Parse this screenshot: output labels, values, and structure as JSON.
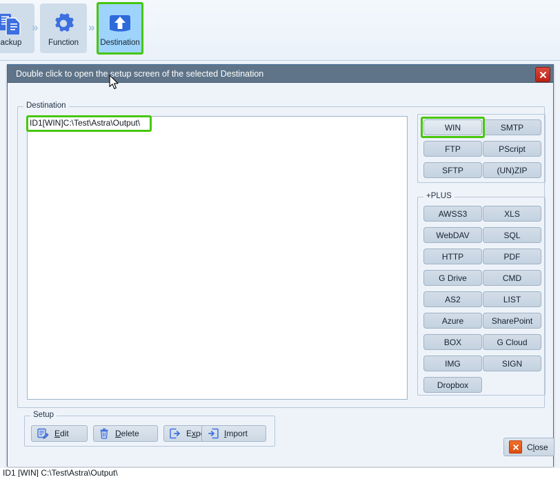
{
  "toolbar": {
    "steps": [
      {
        "label": "ackup",
        "icon": "documents-icon",
        "active": false
      },
      {
        "label": "Function",
        "icon": "gear-icon",
        "active": false
      },
      {
        "label": "Destination",
        "icon": "upload-arrow-icon",
        "active": true
      }
    ],
    "separator": "chevron-right-icon",
    "highlight_color": "#47c60c"
  },
  "dialog": {
    "title": "Double click to open the setup screen of the selected Destination",
    "title_close_icon": "close-x-icon",
    "titlebar_color": "#5f7489",
    "destination_group": {
      "label": "Destination",
      "list_items": [
        {
          "text": "ID1[WIN]C:\\Test\\Astra\\Output\\",
          "selected": true
        }
      ],
      "main_buttons": [
        {
          "label": "WIN",
          "selected": true
        },
        {
          "label": "SMTP",
          "selected": false
        },
        {
          "label": "FTP",
          "selected": false
        },
        {
          "label": "PScript",
          "selected": false
        },
        {
          "label": "SFTP",
          "selected": false
        },
        {
          "label": "(UN)ZIP",
          "selected": false
        }
      ],
      "plus_group": {
        "label": "+PLUS",
        "buttons": [
          {
            "label": "AWSS3"
          },
          {
            "label": "XLS"
          },
          {
            "label": "WebDAV"
          },
          {
            "label": "SQL"
          },
          {
            "label": "HTTP"
          },
          {
            "label": "PDF"
          },
          {
            "label": "G Drive"
          },
          {
            "label": "CMD"
          },
          {
            "label": "AS2"
          },
          {
            "label": "LIST"
          },
          {
            "label": "Azure"
          },
          {
            "label": "SharePoint"
          },
          {
            "label": "BOX"
          },
          {
            "label": "G Cloud"
          },
          {
            "label": "IMG"
          },
          {
            "label": "SIGN"
          },
          {
            "label": "Dropbox"
          }
        ]
      }
    },
    "setup_group": {
      "label": "Setup",
      "buttons": [
        {
          "pre": "",
          "accel": "E",
          "post": "dit",
          "icon": "edit-document-icon"
        },
        {
          "pre": "",
          "accel": "D",
          "post": "elete",
          "icon": "trash-icon"
        },
        {
          "pre": "E",
          "accel": "x",
          "post": "port",
          "icon": "export-arrow-icon"
        },
        {
          "pre": "",
          "accel": "I",
          "post": "mport",
          "icon": "import-arrow-icon"
        }
      ]
    },
    "close_button": {
      "pre": "C",
      "accel": "l",
      "post": "ose",
      "icon": "close-x-icon",
      "icon_color": "#df4a10"
    }
  },
  "background_window": {
    "clipped_bottom_text": "ID1 [WIN] C:\\Test\\Astra\\Output\\"
  }
}
